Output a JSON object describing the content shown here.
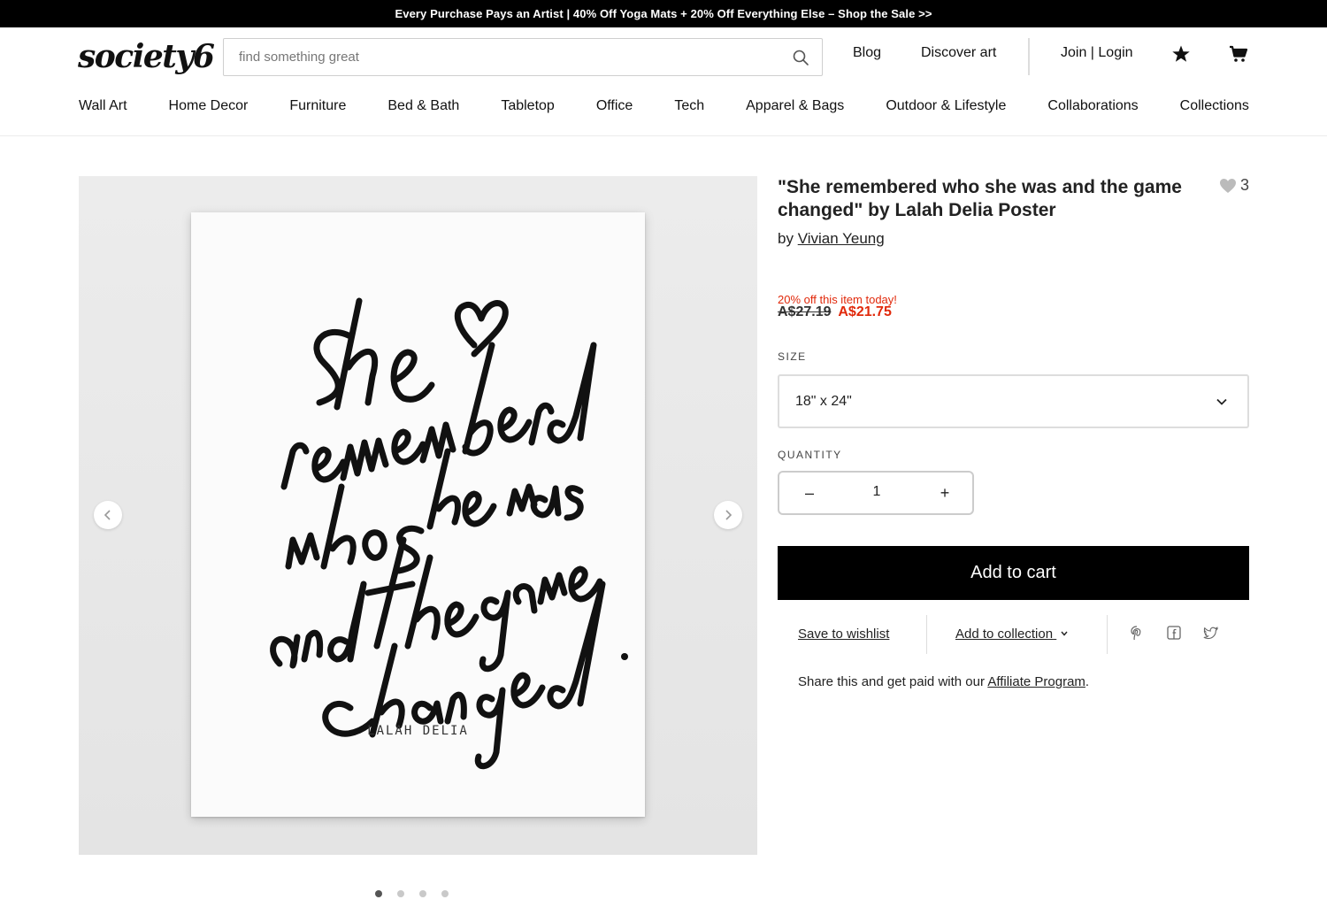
{
  "promo": {
    "text": "Every Purchase Pays an Artist | 40% Off Yoga Mats + 20% Off Everything Else – Shop the Sale >>"
  },
  "header": {
    "logo": "society6",
    "search_placeholder": "find something great",
    "links": {
      "blog": "Blog",
      "discover": "Discover art",
      "account": "Join | Login"
    }
  },
  "nav": {
    "items": [
      "Wall Art",
      "Home Decor",
      "Furniture",
      "Bed & Bath",
      "Tabletop",
      "Office",
      "Tech",
      "Apparel & Bags",
      "Outdoor & Lifestyle",
      "Collaborations",
      "Collections"
    ]
  },
  "product": {
    "title": "\"She remembered who she was and the game changed\" by Lalah Delia Poster",
    "likes": "3",
    "by_prefix": "by",
    "artist": "Vivian Yeung",
    "sale_note": "20% off this item today!",
    "old_price": "A$27.19",
    "new_price": "A$21.75",
    "size_label": "SIZE",
    "size_value": "18\" x 24\"",
    "quantity_label": "QUANTITY",
    "quantity_value": "1",
    "minus": "–",
    "plus": "+",
    "add_to_cart": "Add to cart",
    "save_wishlist": "Save to wishlist",
    "add_collection": "Add to collection",
    "affiliate_prefix": "Share this and get paid with our ",
    "affiliate_link": "Affiliate Program",
    "affiliate_suffix": "."
  },
  "poster": {
    "credit": "LALAH DELIA"
  },
  "gallery": {
    "image_count": 4,
    "active_index": 0
  },
  "colors": {
    "sale_red": "#e1290b",
    "cart_black": "#000000",
    "promo_bg": "#000000"
  },
  "icons": [
    "search-icon",
    "star-icon",
    "cart-icon",
    "heart-icon",
    "chevron-down-icon",
    "chevron-left-icon",
    "chevron-right-icon",
    "pinterest-icon",
    "facebook-icon",
    "twitter-icon"
  ]
}
